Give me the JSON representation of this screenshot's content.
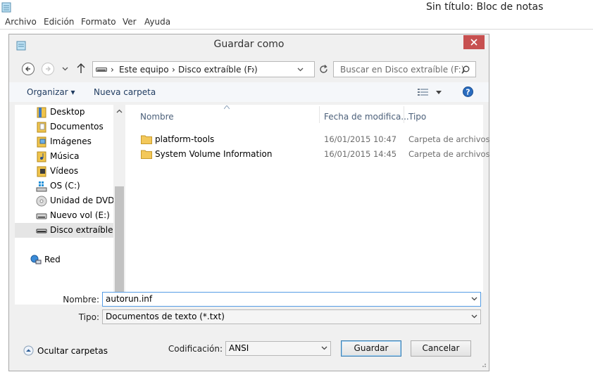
{
  "notepad": {
    "title": "Sin título: Bloc de notas",
    "menu": [
      "Archivo",
      "Edición",
      "Formato",
      "Ver",
      "Ayuda"
    ]
  },
  "dialog": {
    "title": "Guardar como",
    "address": {
      "crumbs": [
        "Este equipo",
        "Disco extraíble (F:)"
      ]
    },
    "search_placeholder": "Buscar en Disco extraíble (F:)",
    "toolbar": {
      "organize": "Organizar",
      "new_folder": "Nueva carpeta"
    },
    "nav_items": [
      {
        "label": "Desktop",
        "icon": "desktop-folder-icon"
      },
      {
        "label": "Documentos",
        "icon": "documents-folder-icon"
      },
      {
        "label": "Imágenes",
        "icon": "pictures-folder-icon"
      },
      {
        "label": "Música",
        "icon": "music-folder-icon"
      },
      {
        "label": "Vídeos",
        "icon": "videos-folder-icon"
      },
      {
        "label": "OS (C:)",
        "icon": "system-drive-icon"
      },
      {
        "label": "Unidad de DVD R",
        "icon": "dvd-drive-icon"
      },
      {
        "label": "Nuevo vol (E:)",
        "icon": "drive-icon"
      },
      {
        "label": "Disco extraíble (F",
        "icon": "removable-drive-icon",
        "selected": true
      },
      {
        "label": "Red",
        "icon": "network-icon"
      }
    ],
    "columns": [
      "Nombre",
      "Fecha de modifica...",
      "Tipo"
    ],
    "files": [
      {
        "name": "platform-tools",
        "date": "16/01/2015 10:47",
        "type": "Carpeta de archivos"
      },
      {
        "name": "System Volume Information",
        "date": "16/01/2015 14:45",
        "type": "Carpeta de archivos"
      }
    ],
    "filename_label": "Nombre:",
    "filename_value": "autorun.inf",
    "type_label": "Tipo:",
    "type_value": "Documentos de texto (*.txt)",
    "hide_folders": "Ocultar carpetas",
    "encoding_label": "Codificación:",
    "encoding_value": "ANSI",
    "save_button": "Guardar",
    "cancel_button": "Cancelar"
  }
}
